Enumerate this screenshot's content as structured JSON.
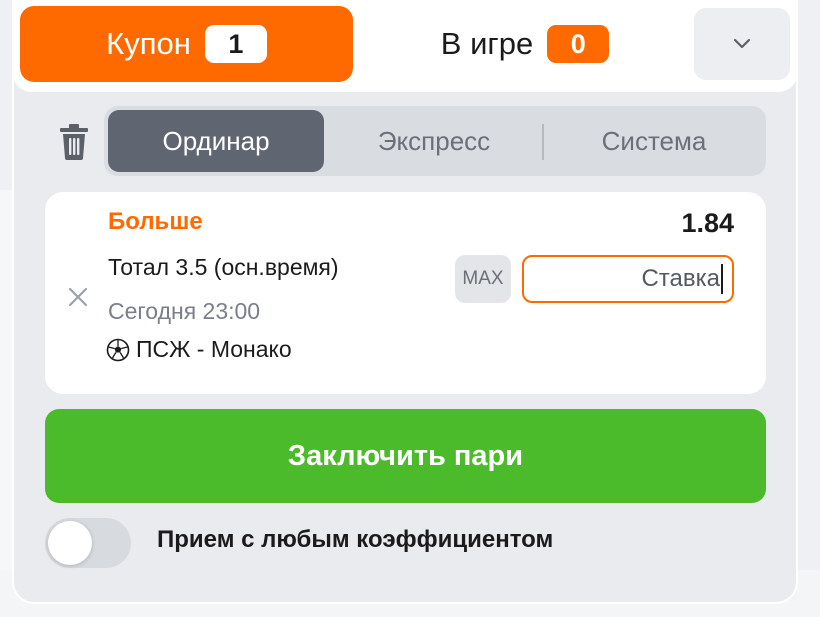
{
  "header": {
    "coupon_tab": {
      "label": "Купон",
      "count": "1"
    },
    "live_tab": {
      "label": "В игре",
      "count": "0"
    },
    "collapse_icon": "chevron-down-icon"
  },
  "toolbar": {
    "trash_icon": "trash-icon",
    "bet_types": [
      "Ординар",
      "Экспресс",
      "Система"
    ],
    "active_bet_type": "Ординар"
  },
  "bet": {
    "outcome": "Больше",
    "odds": "1.84",
    "market": "Тотал 3.5 (осн.время)",
    "time": "Сегодня 23:00",
    "sport_icon": "soccer-ball-icon",
    "match": "ПСЖ - Монако",
    "max_label": "MAX",
    "stake_placeholder": "Ставка",
    "stake_value": ""
  },
  "submit_label": "Заключить пари",
  "accept_any_odds": {
    "label": "Прием с любым коэффициентом",
    "enabled": false
  },
  "colors": {
    "accent": "#ff6a00",
    "submit": "#4cbb2b",
    "segment_active": "#606671"
  }
}
